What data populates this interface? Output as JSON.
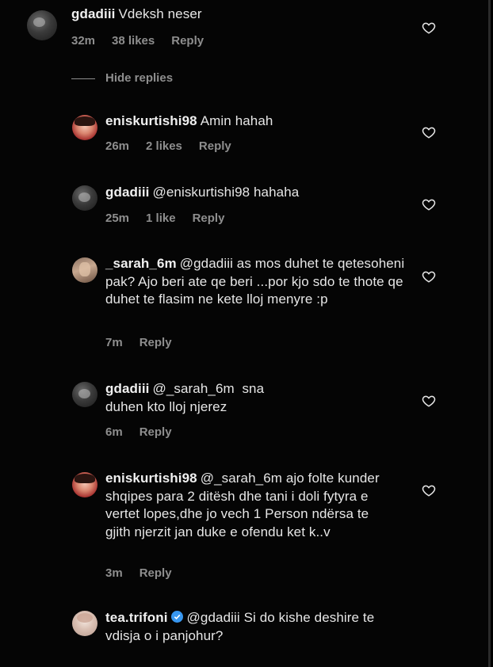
{
  "comments": [
    {
      "username": "gdadiii",
      "text": "Vdeksh neser",
      "time": "32m",
      "likes": "38 likes",
      "reply": "Reply"
    }
  ],
  "hide_replies_label": "Hide replies",
  "replies": [
    {
      "username": "eniskurtishi98",
      "text": "Amin hahah",
      "time": "26m",
      "likes": "2 likes",
      "reply": "Reply"
    },
    {
      "username": "gdadiii",
      "text": "@eniskurtishi98 hahaha",
      "time": "25m",
      "likes": "1 like",
      "reply": "Reply"
    },
    {
      "username": "_sarah_6m",
      "text": "@gdadiii as mos duhet te qetesoheni pak? Ajo beri ate qe beri ...por kjo sdo te thote qe duhet te flasim ne kete lloj menyre :p",
      "time": "7m",
      "reply": "Reply"
    },
    {
      "username": "gdadiii",
      "text": "@_sarah_6m  sna duhen kto lloj njerez",
      "time": "6m",
      "reply": "Reply"
    },
    {
      "username": "eniskurtishi98",
      "text": "@_sarah_6m ajo folte kunder shqipes para 2 ditësh dhe tani i doli fytyra e vertet lopes,dhe jo vech 1 Person ndërsa te gjith njerzit jan duke e ofendu ket k..v",
      "time": "3m",
      "reply": "Reply"
    },
    {
      "username": "tea.trifoni",
      "verified": true,
      "text": "@gdadiii Si do kishe deshire te vdisja o i panjohur?"
    }
  ],
  "icons": {
    "like": "heart-outline-icon",
    "verified": "verified-badge-icon"
  },
  "colors": {
    "background": "#050505",
    "text": "#e6e6e6",
    "muted": "#8e8e8e",
    "verified": "#3897f0"
  }
}
